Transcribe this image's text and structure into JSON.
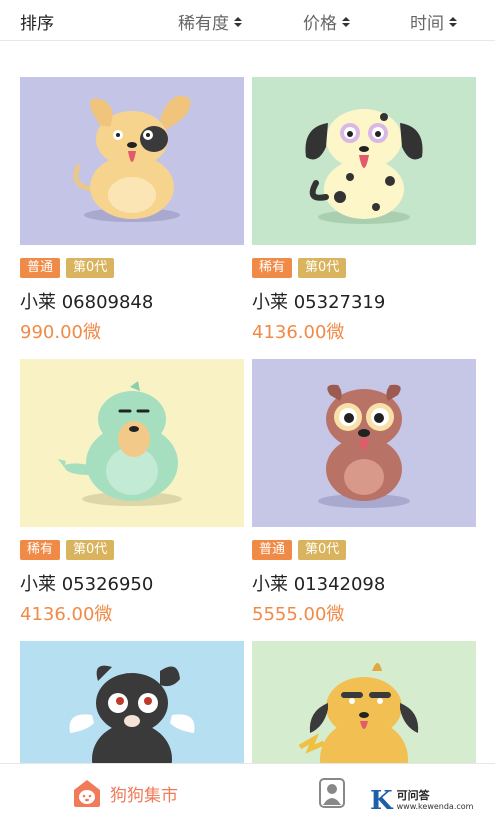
{
  "sort": {
    "title": "排序",
    "options": [
      {
        "label": "稀有度"
      },
      {
        "label": "价格"
      },
      {
        "label": "时间"
      }
    ]
  },
  "cards": [
    {
      "rarity": "普通",
      "generation": "第0代",
      "name": "小莱 06809848",
      "price": "990.00微",
      "bg": "#c4c4e6",
      "dog": "tan-floppy"
    },
    {
      "rarity": "稀有",
      "generation": "第0代",
      "name": "小莱 05327319",
      "price": "4136.00微",
      "bg": "#c6e6cc",
      "dog": "dalmatian"
    },
    {
      "rarity": "稀有",
      "generation": "第0代",
      "name": "小莱 05326950",
      "price": "4136.00微",
      "bg": "#f8f2c4",
      "dog": "green-dino"
    },
    {
      "rarity": "普通",
      "generation": "第0代",
      "name": "小莱 01342098",
      "price": "5555.00微",
      "bg": "#c6c6e6",
      "dog": "brown-pug"
    },
    {
      "bg": "#b6dff2",
      "dog": "black-winged"
    },
    {
      "bg": "#d6ecce",
      "dog": "yellow-lightning"
    }
  ],
  "colors": {
    "accent": "#f08a47",
    "gen_tag": "#d9b35d",
    "nav_active": "#f07a5a"
  },
  "nav": {
    "market_label": "狗狗集市",
    "market_icon": "dog-house-icon",
    "me_icon": "user-icon"
  },
  "watermark": {
    "letter": "K",
    "name": "可问答",
    "url": "www.kewenda.com"
  }
}
